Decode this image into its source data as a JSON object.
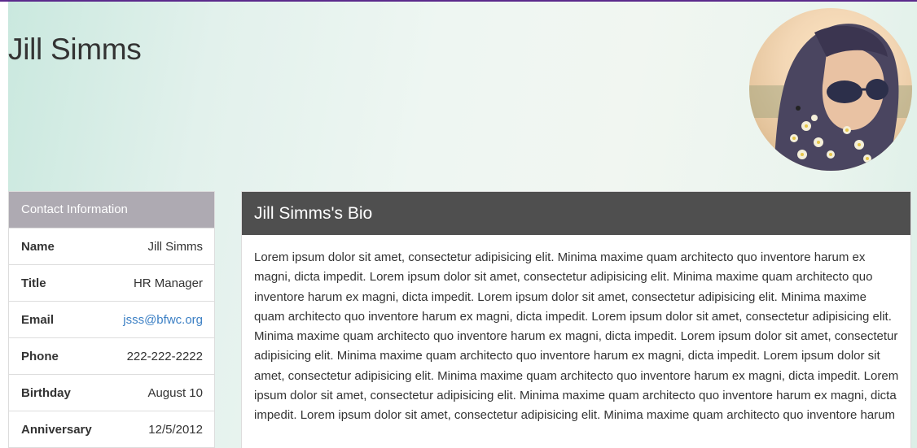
{
  "profile": {
    "name": "Jill Simms",
    "avatar_icon": "profile-photo"
  },
  "contact": {
    "header": "Contact Information",
    "rows": [
      {
        "label": "Name",
        "value": "Jill Simms"
      },
      {
        "label": "Title",
        "value": "HR Manager"
      },
      {
        "label": "Email",
        "value": "jsss@bfwc.org"
      },
      {
        "label": "Phone",
        "value": "222-222-2222"
      },
      {
        "label": "Birthday",
        "value": "August 10"
      },
      {
        "label": "Anniversary",
        "value": "12/5/2012"
      }
    ]
  },
  "bio": {
    "header": "Jill Simms's Bio",
    "text": "Lorem ipsum dolor sit amet, consectetur adipisicing elit. Minima maxime quam architecto quo inventore harum ex magni, dicta impedit. Lorem ipsum dolor sit amet, consectetur adipisicing elit. Minima maxime quam architecto quo inventore harum ex magni, dicta impedit. Lorem ipsum dolor sit amet, consectetur adipisicing elit. Minima maxime quam architecto quo inventore harum ex magni, dicta impedit. Lorem ipsum dolor sit amet, consectetur adipisicing elit. Minima maxime quam architecto quo inventore harum ex magni, dicta impedit. Lorem ipsum dolor sit amet, consectetur adipisicing elit. Minima maxime quam architecto quo inventore harum ex magni, dicta impedit. Lorem ipsum dolor sit amet, consectetur adipisicing elit. Minima maxime quam architecto quo inventore harum ex magni, dicta impedit. Lorem ipsum dolor sit amet, consectetur adipisicing elit. Minima maxime quam architecto quo inventore harum ex magni, dicta impedit. Lorem ipsum dolor sit amet, consectetur adipisicing elit. Minima maxime quam architecto quo inventore harum"
  },
  "colors": {
    "accent_bar": "#5b2a8c",
    "contact_header_bg": "#aeaab2",
    "bio_header_bg": "#4f4f4f",
    "link": "#3b7fc4"
  }
}
